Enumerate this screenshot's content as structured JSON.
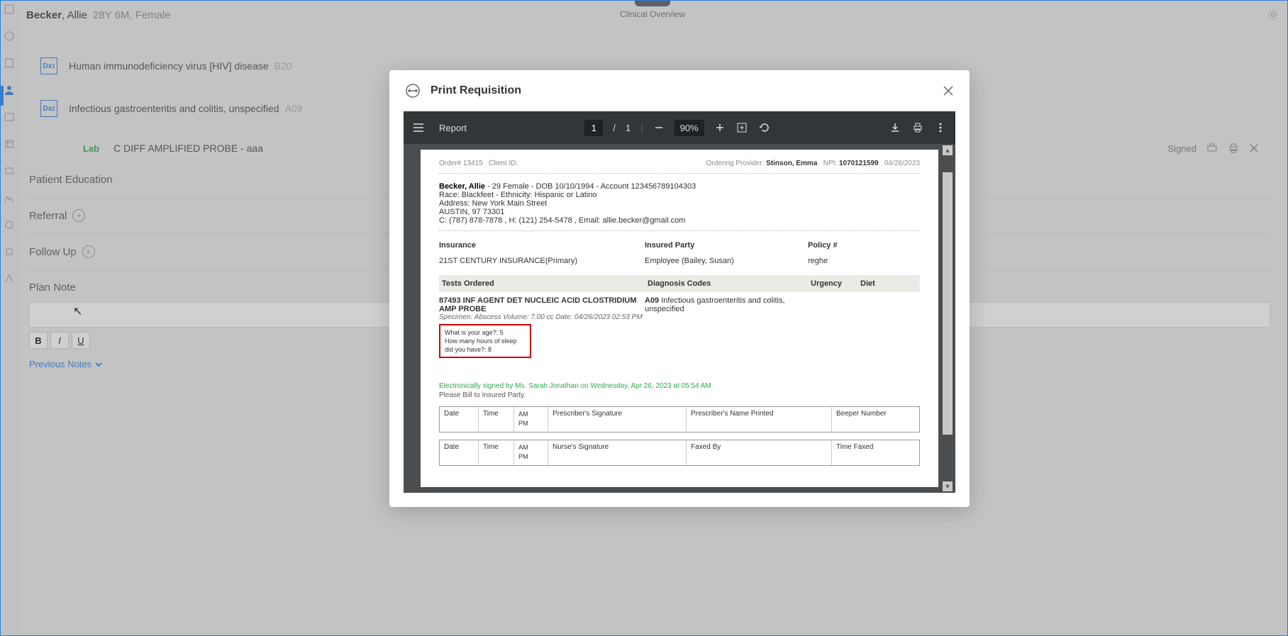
{
  "header": {
    "patient_name_last": "Becker",
    "patient_name_first": "Allie",
    "patient_age_sex": "28Y 6M, Female",
    "tab_label": "Clinical Overview"
  },
  "diagnoses": [
    {
      "badge": "Dx₁",
      "text": "Human immunodeficiency virus [HIV] disease",
      "code": "B20"
    },
    {
      "badge": "Dx₂",
      "text": "Infectious gastroenteritis and colitis, unspecified",
      "code": "A09"
    }
  ],
  "lab": {
    "label": "Lab",
    "text": "C DIFF AMPLIFIED PROBE - aaa",
    "status": "Signed"
  },
  "sections": {
    "patient_education": "Patient Education",
    "referral": "Referral",
    "follow_up": "Follow Up",
    "plan_note": "Plan Note",
    "previous_notes": "Previous Notes"
  },
  "format_buttons": {
    "bold": "B",
    "italic": "I",
    "underline": "U"
  },
  "modal": {
    "title": "Print Requisition",
    "viewer": {
      "doc_title": "Report",
      "page_current": "1",
      "page_sep": "/",
      "page_total": "1",
      "zoom": "90%"
    }
  },
  "doc": {
    "order_label": "Order# ",
    "order_no": "13415",
    "client_label": "Client ID:",
    "ordering_provider_label": "Ordering Provider:",
    "ordering_provider": "Stinson, Emma",
    "npi_label": "NPI:",
    "npi": "1070121599",
    "date": "04/26/2023",
    "patient_name": "Becker, Allie",
    "patient_line1_rest": " - 29 Female - DOB 10/10/1994 - Account 123456789104303",
    "race": "Race: Blackfeet - Ethnicity: Hispanic or Latino",
    "address1": "Address: New York Main Street",
    "address2": "AUSTIN, 97 73301",
    "contact": "C: (787) 878-7878 , H: (121) 254-5478 , Email: allie.becker@gmail.com",
    "ins_h1": "Insurance",
    "ins_h2": "Insured Party",
    "ins_h3": "Policy #",
    "ins_v1": "21ST CENTURY INSURANCE(Primary)",
    "ins_v2": "Employee (Bailey, Susan)",
    "ins_v3": "reghe",
    "tests_h1": "Tests Ordered",
    "tests_h2": "Diagnosis Codes",
    "tests_h3": "Urgency",
    "tests_h4": "Diet",
    "test_name": "87493 INF AGENT DET NUCLEIC ACID CLOSTRIDIUM AMP PROBE",
    "test_dx_code": "A09",
    "test_dx_text": " Infectious gastroenteritis and colitis, unspecified",
    "specimen": "Specimen: Abscess Volume: 7.00 cc Date: 04/26/2023 02:53 PM",
    "qa1": "What is your age?: 5",
    "qa2": "How many hours of sleep did you have?: 8",
    "esign": "Electronically signed by Ms. Sarah Jonathan  on Wednesday, Apr 26, 2023 at 05:54 AM",
    "bill": "Please Bill to Insured Party.",
    "sig1": {
      "c1": "Date",
      "c2": "Time",
      "c3a": "AM",
      "c3b": "PM",
      "c4": "Prescriber's Signature",
      "c5": "Prescriber's Name Printed",
      "c6": "Beeper Number"
    },
    "sig2": {
      "c1": "Date",
      "c2": "Time",
      "c3a": "AM",
      "c3b": "PM",
      "c4": "Nurse's Signature",
      "c5": "Faxed By",
      "c6": "Time Faxed"
    }
  }
}
